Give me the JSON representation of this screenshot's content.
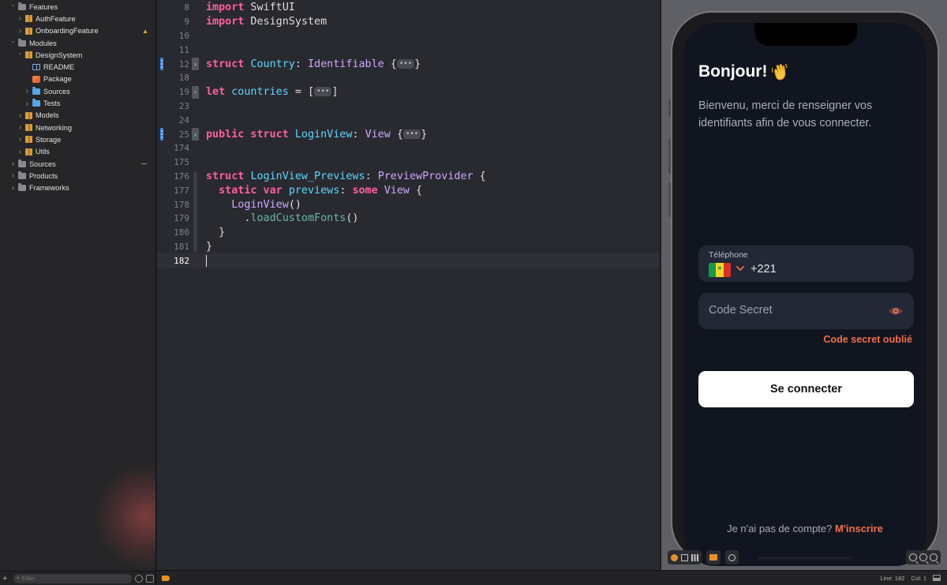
{
  "sidebar": {
    "items": [
      {
        "label": "Features",
        "indent": 0,
        "icon": "folder-icon",
        "expanded": true
      },
      {
        "label": "AuthFeature",
        "indent": 1,
        "icon": "package-icon",
        "expanded": false
      },
      {
        "label": "OnboardingFeature",
        "indent": 1,
        "icon": "package-icon",
        "expanded": false,
        "badge": "▲"
      },
      {
        "label": "Modules",
        "indent": 0,
        "icon": "folder-icon",
        "expanded": true
      },
      {
        "label": "DesignSystem",
        "indent": 1,
        "icon": "package-icon",
        "expanded": true
      },
      {
        "label": "README",
        "indent": 2,
        "icon": "book-icon"
      },
      {
        "label": "Package",
        "indent": 2,
        "icon": "swift-icon"
      },
      {
        "label": "Sources",
        "indent": 2,
        "icon": "blue-folder-icon",
        "expanded": false
      },
      {
        "label": "Tests",
        "indent": 2,
        "icon": "blue-folder-icon",
        "expanded": false
      },
      {
        "label": "Models",
        "indent": 1,
        "icon": "package-icon",
        "expanded": false
      },
      {
        "label": "Networking",
        "indent": 1,
        "icon": "package-icon",
        "expanded": false
      },
      {
        "label": "Storage",
        "indent": 1,
        "icon": "package-icon",
        "expanded": false
      },
      {
        "label": "Utils",
        "indent": 1,
        "icon": "package-icon",
        "expanded": false
      },
      {
        "label": "Sources",
        "indent": 0,
        "icon": "folder-icon",
        "expanded": false,
        "dash": true
      },
      {
        "label": "Products",
        "indent": 0,
        "icon": "folder-icon",
        "expanded": false
      },
      {
        "label": "Frameworks",
        "indent": 0,
        "icon": "folder-icon",
        "expanded": false
      }
    ],
    "filter_placeholder": "Filter"
  },
  "editor": {
    "lines": [
      {
        "num": "8",
        "tokens": [
          [
            "kw",
            "import"
          ],
          [
            "t",
            " SwiftUI"
          ]
        ]
      },
      {
        "num": "9",
        "tokens": [
          [
            "kw",
            "import"
          ],
          [
            "t",
            " DesignSystem"
          ]
        ]
      },
      {
        "num": "10",
        "tokens": []
      },
      {
        "num": "11",
        "tokens": []
      },
      {
        "num": "12",
        "fold": true,
        "ribbon": true,
        "tokens": [
          [
            "kw",
            "struct"
          ],
          [
            "t",
            " "
          ],
          [
            "decl",
            "Country"
          ],
          [
            "t",
            ": "
          ],
          [
            "ty",
            "Identifiable"
          ],
          [
            "t",
            " {"
          ],
          [
            "fold",
            "•••"
          ],
          [
            "t",
            "}"
          ]
        ]
      },
      {
        "num": "18",
        "tokens": []
      },
      {
        "num": "19",
        "fold": true,
        "tokens": [
          [
            "kw",
            "let"
          ],
          [
            "t",
            " "
          ],
          [
            "decl",
            "countries"
          ],
          [
            "t",
            " = ["
          ],
          [
            "fold",
            "•••"
          ],
          [
            "t",
            "]"
          ]
        ]
      },
      {
        "num": "23",
        "tokens": []
      },
      {
        "num": "24",
        "tokens": []
      },
      {
        "num": "25",
        "fold": true,
        "ribbon": true,
        "tokens": [
          [
            "kw",
            "public struct"
          ],
          [
            "t",
            " "
          ],
          [
            "decl",
            "LoginView"
          ],
          [
            "t",
            ": "
          ],
          [
            "ty",
            "View"
          ],
          [
            "t",
            " {"
          ],
          [
            "fold",
            "•••"
          ],
          [
            "t",
            "}"
          ]
        ]
      },
      {
        "num": "174",
        "tokens": []
      },
      {
        "num": "175",
        "tokens": []
      },
      {
        "num": "176",
        "tokens": [
          [
            "kw",
            "struct"
          ],
          [
            "t",
            " "
          ],
          [
            "decl",
            "LoginView_Previews"
          ],
          [
            "t",
            ": "
          ],
          [
            "ty",
            "PreviewProvider"
          ],
          [
            "t",
            " {"
          ]
        ]
      },
      {
        "num": "177",
        "tokens": [
          [
            "t",
            "  "
          ],
          [
            "kw",
            "static var"
          ],
          [
            "t",
            " "
          ],
          [
            "decl",
            "previews"
          ],
          [
            "t",
            ": "
          ],
          [
            "kw",
            "some"
          ],
          [
            "t",
            " "
          ],
          [
            "ty",
            "View"
          ],
          [
            "t",
            " {"
          ]
        ]
      },
      {
        "num": "178",
        "tokens": [
          [
            "t",
            "    "
          ],
          [
            "ty",
            "LoginView"
          ],
          [
            "t",
            "()"
          ]
        ]
      },
      {
        "num": "179",
        "tokens": [
          [
            "t",
            "      ."
          ],
          [
            "fn",
            "loadCustomFonts"
          ],
          [
            "t",
            "()"
          ]
        ]
      },
      {
        "num": "180",
        "tokens": [
          [
            "t",
            "  }"
          ]
        ]
      },
      {
        "num": "181",
        "tokens": [
          [
            "t",
            "}"
          ]
        ]
      },
      {
        "num": "182",
        "current": true,
        "tokens": []
      }
    ]
  },
  "status": {
    "line": "Line: 182",
    "col": "Col: 1"
  },
  "preview": {
    "greeting": "Bonjour!",
    "subtitle": "Bienvenu, merci de renseigner vos identifiants afin de vous connecter.",
    "phone_label": "Téléphone",
    "dial_code": "+221",
    "password_placeholder": "Code Secret",
    "forgot": "Code secret oublié",
    "login_button": "Se connecter",
    "no_account": "Je n'ai pas de compte?",
    "signup_link": "M'inscrire",
    "accent_color": "#ee6f4a",
    "background_color": "#11151f"
  }
}
